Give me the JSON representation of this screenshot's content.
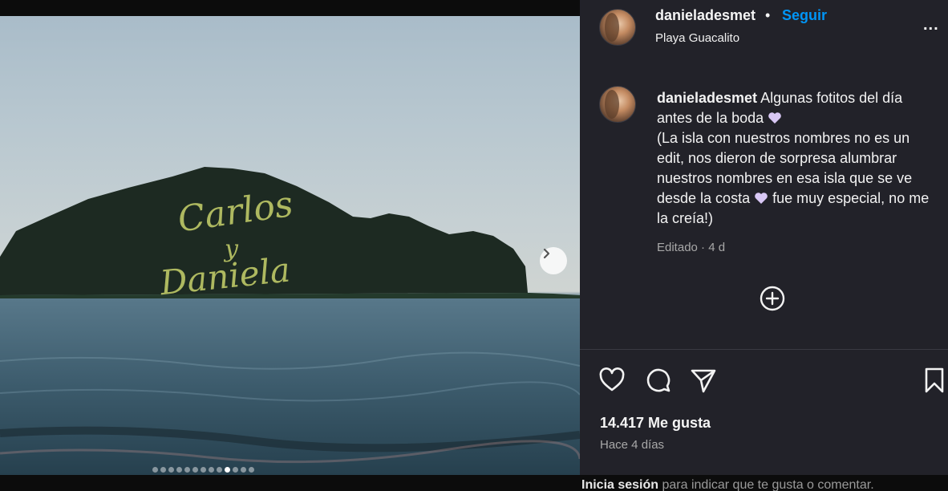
{
  "post": {
    "username": "danieladesmet",
    "separator": "•",
    "follow_label": "Seguir",
    "location": "Playa Guacalito",
    "more_label": "..."
  },
  "caption": {
    "username": "danieladesmet",
    "line1": "Algunas fotitos del día antes de la boda",
    "line2": "(La isla con nuestros nombres no es un edit, nos dieron de sorpresa alumbrar nuestros nombres en esa isla que se ve desde la costa",
    "line3": "fue muy especial, no me la creía!)",
    "meta": "Editado · 4 d",
    "heart_color": "#d9c8f5"
  },
  "photo": {
    "overlay_text": [
      "Carlos",
      "y",
      "Daniela"
    ],
    "carousel_total": 13,
    "carousel_active": 10
  },
  "actions": {
    "likes": "14.417 Me gusta",
    "time_ago": "Hace 4 días"
  },
  "footer": {
    "login_link": "Inicia sesión",
    "login_rest": " para indicar que te gusta o comentar."
  },
  "colors": {
    "accent": "#0095f6",
    "panel_bg": "#222229"
  }
}
